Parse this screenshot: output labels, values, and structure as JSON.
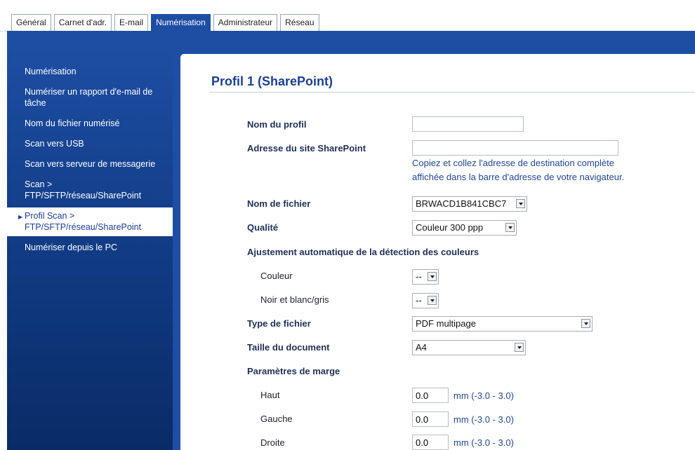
{
  "tabs": [
    {
      "label": "Général"
    },
    {
      "label": "Carnet d'adr."
    },
    {
      "label": "E-mail"
    },
    {
      "label": "Numérisation"
    },
    {
      "label": "Administrateur"
    },
    {
      "label": "Réseau"
    }
  ],
  "sidebar": {
    "items": [
      {
        "label": "Numérisation"
      },
      {
        "label": "Numériser un rapport d'e-mail de tâche"
      },
      {
        "label": "Nom du fichier numérisé"
      },
      {
        "label": "Scan vers USB"
      },
      {
        "label": "Scan vers serveur de messagerie"
      },
      {
        "label": "Scan > FTP/SFTP/réseau/SharePoint"
      },
      {
        "label": "Profil Scan > FTP/SFTP/réseau/SharePoint"
      },
      {
        "label": "Numériser depuis le PC"
      }
    ]
  },
  "main": {
    "title": "Profil 1 (SharePoint)",
    "profile_name_label": "Nom du profil",
    "profile_name_value": "",
    "site_address_label": "Adresse du site SharePoint",
    "site_address_value": "",
    "site_hint_line1": "Copiez et collez l'adresse de destination complète",
    "site_hint_line2": "affichée dans la barre d'adresse de votre navigateur.",
    "file_name_label": "Nom de fichier",
    "file_name_value": "BRWACD1B841CBC7",
    "quality_label": "Qualité",
    "quality_value": "Couleur 300 ppp",
    "auto_color_label": "Ajustement automatique de la détection des couleurs",
    "color_label": "Couleur",
    "color_value": "--",
    "bw_label": "Noir et blanc/gris",
    "bw_value": "--",
    "file_type_label": "Type de fichier",
    "file_type_value": "PDF multipage",
    "doc_size_label": "Taille du document",
    "doc_size_value": "A4",
    "margin_label": "Paramètres de marge",
    "margin_top_label": "Haut",
    "margin_top_value": "0.0",
    "margin_left_label": "Gauche",
    "margin_left_value": "0.0",
    "margin_right_label": "Droite",
    "margin_right_value": "0.0",
    "margin_unit": "mm (-3.0 - 3.0)"
  }
}
